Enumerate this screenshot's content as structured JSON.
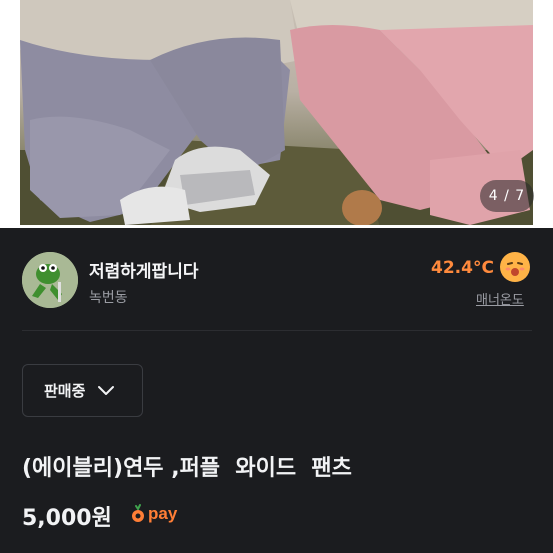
{
  "photo": {
    "counter": "4 / 7"
  },
  "seller": {
    "name": "저렴하게팝니다",
    "region": "녹번동",
    "temperature": "42.4°C",
    "manner_label": "매너온도"
  },
  "listing": {
    "status": "판매중",
    "title": "(에이블리)연두 ,퍼플  와이드  팬츠",
    "price": "5,000원",
    "pay_label": "pay"
  },
  "colors": {
    "background": "#1b1c1f",
    "accent": "#ff7e36",
    "temperature": "#ff8a3d"
  }
}
